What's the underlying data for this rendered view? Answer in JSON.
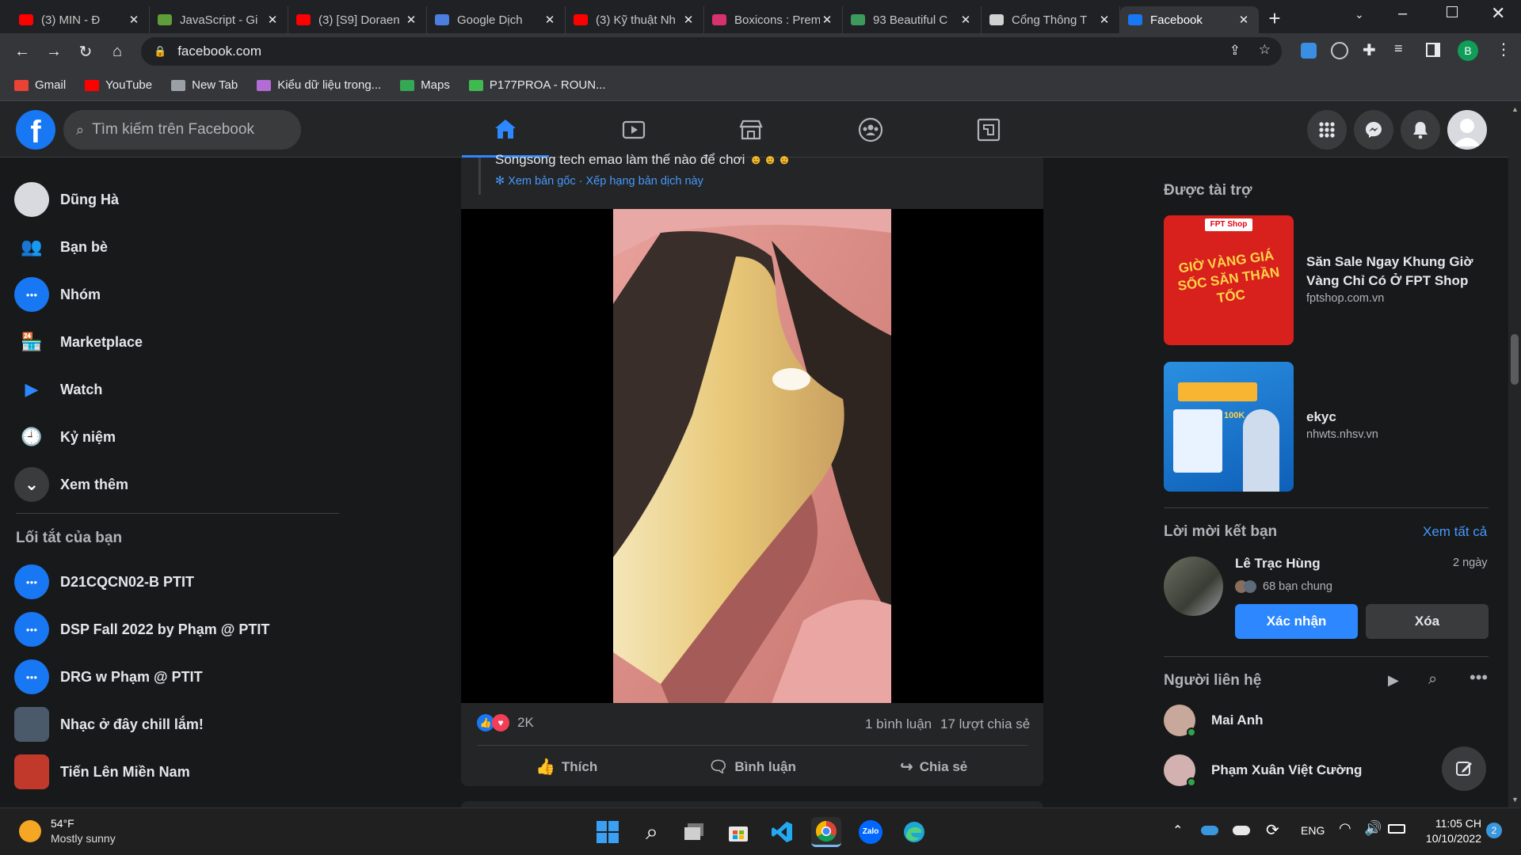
{
  "browser": {
    "tabs": [
      {
        "title": "(3) MIN - Đ",
        "icon": "youtube-icon",
        "color": "#ff0000"
      },
      {
        "title": "JavaScript - Gi",
        "icon": "gitlab-icon",
        "color": "#5f9c3a"
      },
      {
        "title": "(3) [S9] Doraen",
        "icon": "youtube-icon",
        "color": "#ff0000"
      },
      {
        "title": "Google Dịch",
        "icon": "google-translate-icon",
        "color": "#4a7fe0"
      },
      {
        "title": "(3) Kỹ thuật Nh",
        "icon": "youtube-icon",
        "color": "#ff0000"
      },
      {
        "title": "Boxicons : Prem",
        "icon": "boxicons-icon",
        "color": "#d6336c"
      },
      {
        "title": "93 Beautiful C",
        "icon": "codepen-icon",
        "color": "#3c9a5f"
      },
      {
        "title": "Cổng Thông T",
        "icon": "portal-icon",
        "color": "#d0d0d0"
      },
      {
        "title": "Facebook",
        "icon": "facebook-icon",
        "color": "#1877f2",
        "active": true
      }
    ],
    "url": "facebook.com",
    "bookmarks": [
      {
        "label": "Gmail",
        "icon": "gmail-icon",
        "color": "#ea4335"
      },
      {
        "label": "YouTube",
        "icon": "youtube-icon",
        "color": "#ff0000"
      },
      {
        "label": "New Tab",
        "icon": "globe-icon",
        "color": "#9aa0a6"
      },
      {
        "label": "Kiểu dữ liệu trong...",
        "icon": "q-icon",
        "color": "#b36bd6"
      },
      {
        "label": "Maps",
        "icon": "maps-icon",
        "color": "#34a853"
      },
      {
        "label": "P177PROA - ROUN...",
        "icon": "diamond-icon",
        "color": "#3fb950"
      }
    ],
    "profile_initial": "B"
  },
  "fb": {
    "search_placeholder": "Tìm kiếm trên Facebook",
    "left_menu": [
      {
        "label": "Dũng Hà",
        "icon": "avatar-icon"
      },
      {
        "label": "Bạn bè",
        "icon": "friends-icon"
      },
      {
        "label": "Nhóm",
        "icon": "groups-icon"
      },
      {
        "label": "Marketplace",
        "icon": "marketplace-icon"
      },
      {
        "label": "Watch",
        "icon": "watch-icon"
      },
      {
        "label": "Kỷ niệm",
        "icon": "memories-icon"
      },
      {
        "label": "Xem thêm",
        "icon": "chevron-down-icon"
      }
    ],
    "shortcuts_title": "Lối tắt của bạn",
    "shortcuts": [
      {
        "label": "D21CQCN02-B PTIT"
      },
      {
        "label": "DSP Fall 2022 by Phạm @ PTIT"
      },
      {
        "label": "DRG w Phạm @ PTIT"
      },
      {
        "label": "Nhạc ở đây chill lắm!"
      },
      {
        "label": "Tiến Lên Miền Nam"
      }
    ],
    "post": {
      "text_partial": "Songsong tech emao làm thế nào để chơi",
      "translate_link": "Xem bản gốc · Xếp hạng bản dịch này",
      "reactions_count": "2K",
      "comments": "1 bình luận",
      "shares": "17 lượt chia sẻ",
      "actions": {
        "like": "Thích",
        "comment": "Bình luận",
        "share": "Chia sẻ"
      }
    },
    "sponsored": {
      "title": "Được tài trợ",
      "ads": [
        {
          "headline": "Săn Sale Ngay Khung Giờ Vàng Chỉ Có Ở FPT Shop",
          "domain": "fptshop.com.vn",
          "image_text": "GIỜ VÀNG GIÁ SỐC SĂN THẦN TỐC"
        },
        {
          "headline": "ekyc",
          "domain": "nhwts.nhsv.vn",
          "image_text": "100K"
        }
      ]
    },
    "friend_requests": {
      "title": "Lời mời kết bạn",
      "see_all": "Xem tất cả",
      "name": "Lê Trạc Hùng",
      "time": "2 ngày",
      "mutual": "68 bạn chung",
      "confirm": "Xác nhận",
      "delete": "Xóa"
    },
    "contacts": {
      "title": "Người liên hệ",
      "list": [
        {
          "name": "Mai Anh"
        },
        {
          "name": "Phạm Xuân Việt Cường"
        }
      ]
    }
  },
  "taskbar": {
    "weather_temp": "54°F",
    "weather_desc": "Mostly sunny",
    "lang": "ENG",
    "time": "11:05 CH",
    "date": "10/10/2022",
    "notifications": "2"
  }
}
